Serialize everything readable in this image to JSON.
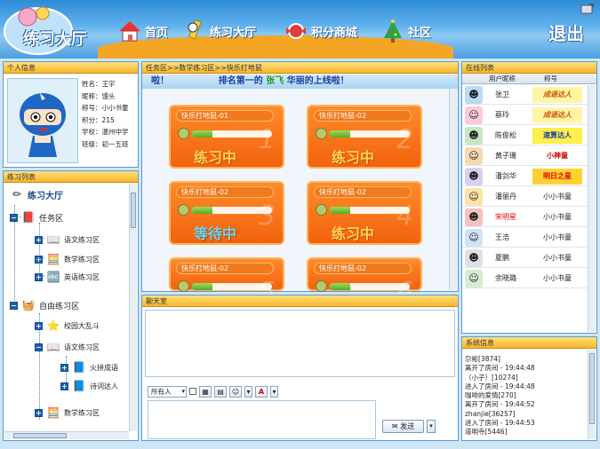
{
  "header": {
    "logo_text": "练习大厅",
    "nav": [
      {
        "label": "首页",
        "icon": "house-icon"
      },
      {
        "label": "练习大厅",
        "icon": "pencil-mascot-icon"
      },
      {
        "label": "积分商城",
        "icon": "candy-icon"
      },
      {
        "label": "社区",
        "icon": "christmas-tree-icon"
      }
    ],
    "exit_label": "退出"
  },
  "personal": {
    "title": "个人信息",
    "lines": [
      "姓名：王宇",
      "昵称：馒头",
      "称号：小小书童",
      "积分：215",
      "",
      "学校：温州中学",
      "班级：初一五班"
    ]
  },
  "practice_list": {
    "title": "练习列表",
    "root": "练习大厅",
    "items": [
      "任务区",
      "语文练习区",
      "数学练习区",
      "英语练习区",
      "自由练习区",
      "校园大乱斗",
      "语文练习区",
      "火拼成语",
      "诗词达人",
      "数学练习区"
    ]
  },
  "main": {
    "breadcrumb": "任务区>>数学练习区>>快乐打地鼠",
    "marquee": {
      "part1": "排名第一的",
      "part2": "张飞",
      "part3": "华丽的上线啦！"
    },
    "rooms": [
      {
        "name": "快乐打地鼠-01",
        "status": "练习中",
        "progress": 0.25,
        "num": "1"
      },
      {
        "name": "快乐打地鼠-02",
        "status": "练习中",
        "progress": 0.25,
        "num": "2"
      },
      {
        "name": "快乐打地鼠-02",
        "status": "等待中",
        "progress": 0.25,
        "num": "3"
      },
      {
        "name": "快乐打地鼠-02",
        "status": "练习中",
        "progress": 0.25,
        "num": "4"
      },
      {
        "name": "快乐打地鼠-02",
        "status": "",
        "progress": 0.25,
        "num": "5"
      },
      {
        "name": "快乐打地鼠-02",
        "status": "",
        "progress": 0.25,
        "num": "6"
      }
    ]
  },
  "chat": {
    "title": "聊天室",
    "recipient": "所有人",
    "send_label": "发送",
    "font_color_label": "A"
  },
  "online": {
    "title": "在线列表",
    "col_nick": "用户昵称",
    "col_title": "称号",
    "users": [
      {
        "name": "张卫",
        "title": "成语达人",
        "badge": "t-badge1"
      },
      {
        "name": "蔡玲",
        "title": "成语达人",
        "badge": "t-badge1"
      },
      {
        "name": "陈俊松",
        "title": "速算达人",
        "badge": "t-badge2"
      },
      {
        "name": "黄子珊",
        "title": "小神童",
        "badge": "t-badge3"
      },
      {
        "name": "潘剑华",
        "title": "明日之星",
        "badge": "t-badge4"
      },
      {
        "name": "潘丽丹",
        "title": "小小书童",
        "badge": "plain"
      },
      {
        "name": "宋明星",
        "title": "小小书童",
        "badge": "plain",
        "highlight": true
      },
      {
        "name": "王浩",
        "title": "小小书童",
        "badge": "plain"
      },
      {
        "name": "夏鹏",
        "title": "小小书童",
        "badge": "plain"
      },
      {
        "name": "余晓璐",
        "title": "小小书童",
        "badge": "plain"
      }
    ]
  },
  "system": {
    "title": "系统信息",
    "lines": [
      "尕彬[3874]",
      "离开了房间 - 19:44:48",
      "（小子）[10274]",
      "进入了房间 - 19:44:48",
      "咖啡的爱情[270]",
      "离开了房间 - 19:44:52",
      "zhanjie[36257]",
      "进入了房间 - 19:44:53",
      " 道明寺[5446]"
    ]
  }
}
